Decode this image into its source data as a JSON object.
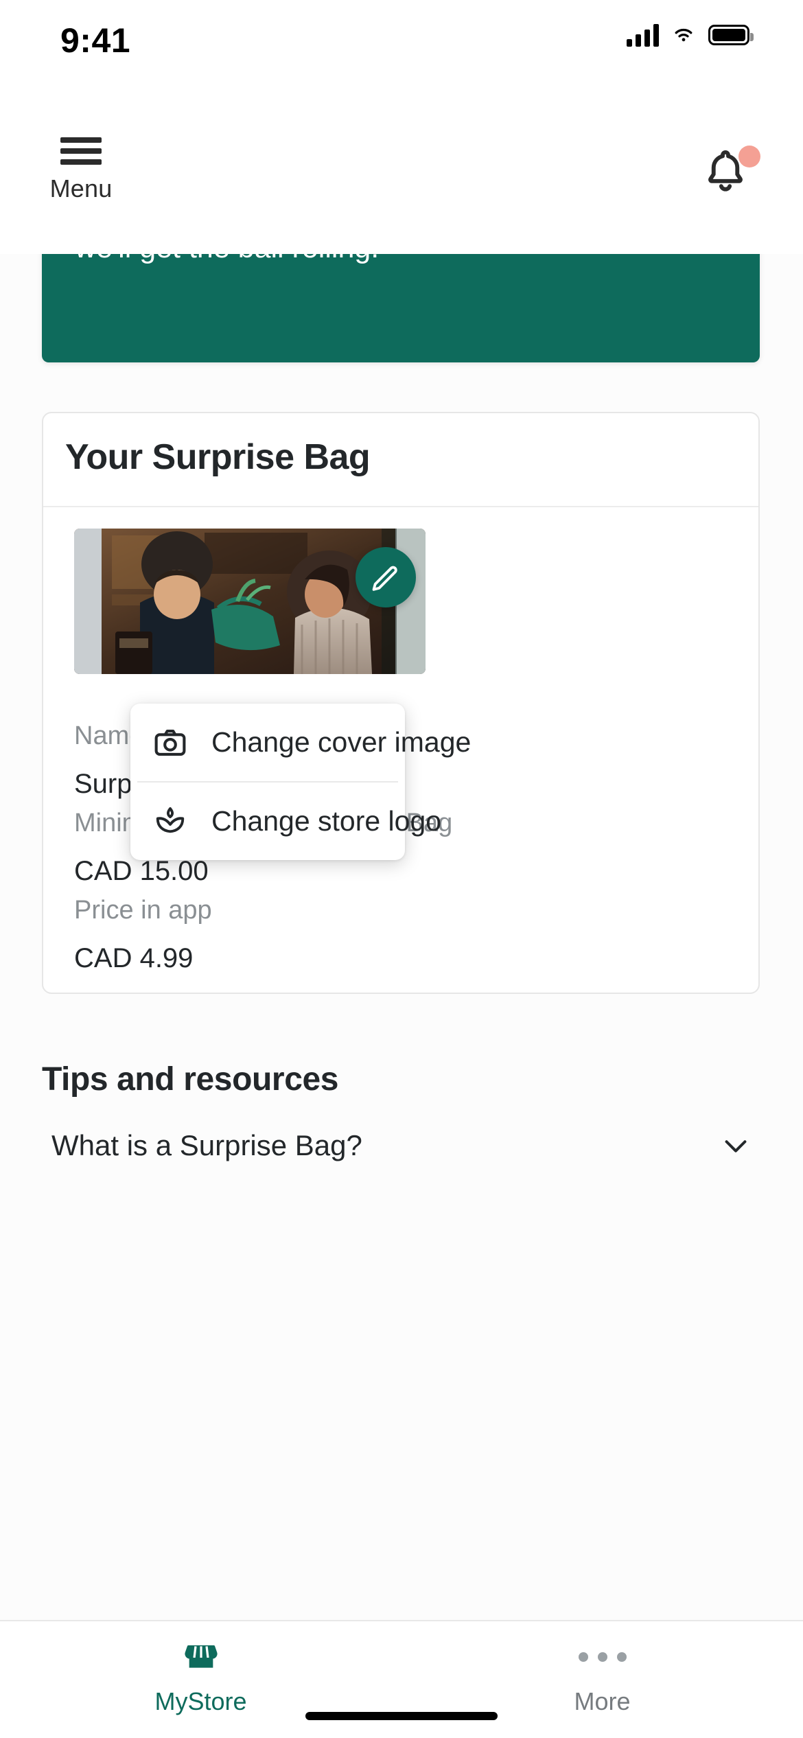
{
  "statusbar": {
    "time": "9:41",
    "cellular_icon": "cellular-signal-icon",
    "wifi_icon": "wifi-icon",
    "battery_icon": "battery-full-icon"
  },
  "header": {
    "menu_label": "Menu",
    "menu_icon": "hamburger-menu-icon",
    "notification_icon": "bell-icon",
    "notification_badge": true
  },
  "banner": {
    "text": "get started, you can reach out to us directly and we'll get the ball rolling.",
    "background_color": "#0E6B5C",
    "text_color": "#FFFFFF"
  },
  "card": {
    "title": "Your Surprise Bag",
    "cover_image_alt": "store-cover-photo",
    "edit_icon": "pencil-icon",
    "edit_button_color": "#0E6B5C",
    "fields": [
      {
        "label": "Name",
        "value": "Surprise Bag"
      },
      {
        "label": "Minimum value per Surprise Bag",
        "value": "CAD 15.00"
      },
      {
        "label": "Price in app",
        "value": "CAD 4.99"
      }
    ]
  },
  "popup_menu": {
    "items": [
      {
        "label": "Change cover image",
        "icon": "camera-icon"
      },
      {
        "label": "Change store logo",
        "icon": "lotus-logo-icon"
      }
    ]
  },
  "tips": {
    "title": "Tips and resources",
    "items": [
      {
        "label": "What is a Surprise Bag?",
        "chevron_icon": "chevron-down-icon"
      }
    ]
  },
  "tabbar": {
    "tabs": [
      {
        "label": "MyStore",
        "icon": "storefront-icon",
        "active": true
      },
      {
        "label": "More",
        "icon": "ellipsis-icon",
        "active": false
      }
    ],
    "active_color": "#0E6B5C",
    "inactive_color": "#767B7F"
  }
}
